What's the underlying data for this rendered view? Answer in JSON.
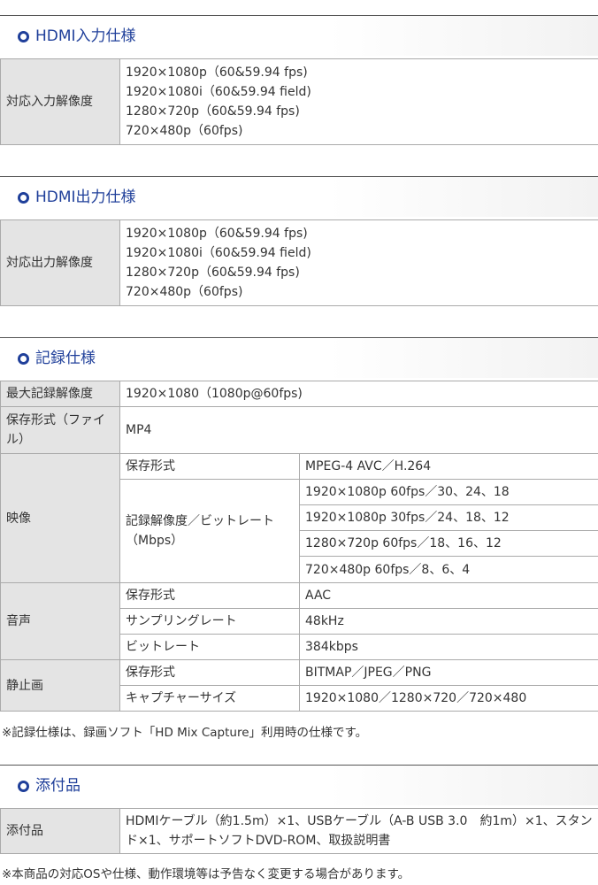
{
  "hdmi_input": {
    "title": "HDMI入力仕様",
    "label": "対応入力解像度",
    "values": [
      "1920×1080p（60&59.94 fps)",
      "1920×1080i（60&59.94 field)",
      "1280×720p（60&59.94 fps)",
      "720×480p（60fps)"
    ]
  },
  "hdmi_output": {
    "title": "HDMI出力仕様",
    "label": "対応出力解像度",
    "values": [
      "1920×1080p（60&59.94 fps)",
      "1920×1080i（60&59.94 field)",
      "1280×720p（60&59.94 fps)",
      "720×480p（60fps)"
    ]
  },
  "recording": {
    "title": "記録仕様",
    "max_res_label": "最大記録解像度",
    "max_res_value": "1920×1080（1080p@60fps)",
    "file_format_label": "保存形式（ファイル）",
    "file_format_value": "MP4",
    "video": {
      "label": "映像",
      "format_label": "保存形式",
      "format_value": "MPEG-4 AVC／H.264",
      "bitrate_label": "記録解像度／ビットレート（Mbps）",
      "bitrates": [
        "1920×1080p 60fps／30、24、18",
        "1920×1080p 30fps／24、18、12",
        "1280×720p 60fps／18、16、12",
        "720×480p 60fps／8、6、4"
      ]
    },
    "audio": {
      "label": "音声",
      "format_label": "保存形式",
      "format_value": "AAC",
      "sampling_label": "サンプリングレート",
      "sampling_value": "48kHz",
      "bitrate_label": "ビットレート",
      "bitrate_value": "384kbps"
    },
    "still": {
      "label": "静止画",
      "format_label": "保存形式",
      "format_value": "BITMAP／JPEG／PNG",
      "capture_label": "キャプチャーサイズ",
      "capture_value": "1920×1080／1280×720／720×480"
    },
    "note": "※記録仕様は、録画ソフト「HD Mix Capture」利用時の仕様です。"
  },
  "accessories": {
    "title": "添付品",
    "label": "添付品",
    "value": "HDMIケーブル（約1.5m）×1、USBケーブル（A-B USB 3.0　約1m）×1、スタンド×1、サポートソフトDVD-ROM、取扱説明書"
  },
  "footer_note": "※本商品の対応OSや仕様、動作環境等は予告なく変更する場合があります。",
  "colors": {
    "accent": "#1f3f9a",
    "header_cell": "#e4e4e4",
    "border": "#aaaaaa"
  }
}
